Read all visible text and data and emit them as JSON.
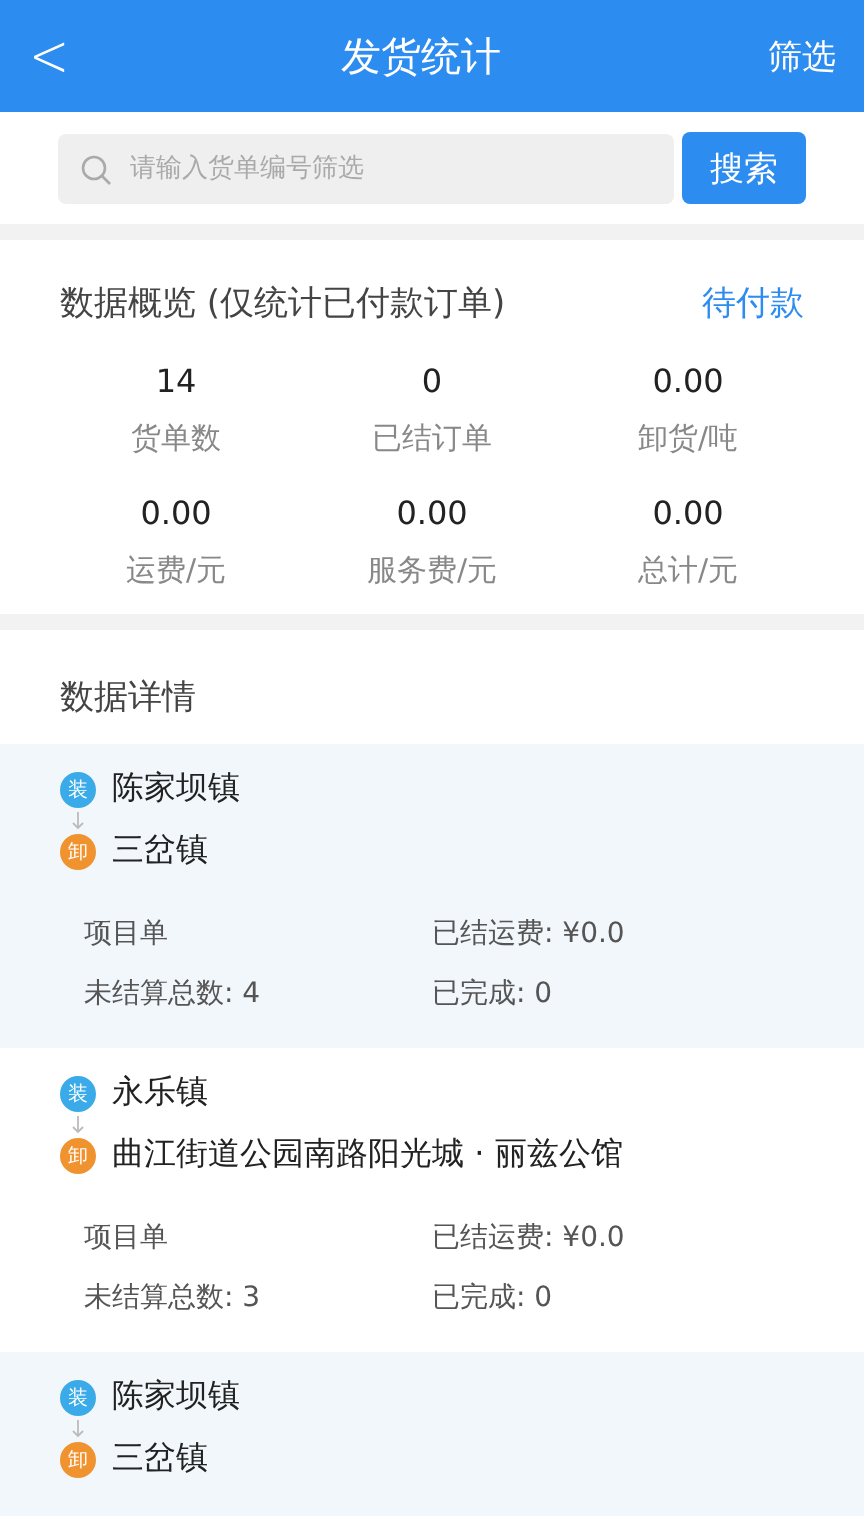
{
  "header": {
    "back": "<",
    "title": "发货统计",
    "action": "筛选"
  },
  "search": {
    "placeholder": "请输入货单编号筛选",
    "button": "搜索"
  },
  "overview": {
    "title": "数据概览 (仅统计已付款订单)",
    "link": "待付款",
    "stats": [
      {
        "value": "14",
        "label": "货单数"
      },
      {
        "value": "0",
        "label": "已结订单"
      },
      {
        "value": "0.00",
        "label": "卸货/吨"
      },
      {
        "value": "0.00",
        "label": "运费/元"
      },
      {
        "value": "0.00",
        "label": "服务费/元"
      },
      {
        "value": "0.00",
        "label": "总计/元"
      }
    ]
  },
  "details": {
    "title": "数据详情",
    "records": [
      {
        "load_tag": "装",
        "load": "陈家坝镇",
        "unload_tag": "卸",
        "unload": "三岔镇",
        "fields": [
          "项目单",
          "已结运费: ¥0.0",
          "未结算总数: 4",
          "已完成: 0"
        ]
      },
      {
        "load_tag": "装",
        "load": "永乐镇",
        "unload_tag": "卸",
        "unload": "曲江街道公园南路阳光城 · 丽兹公馆",
        "fields": [
          "项目单",
          "已结运费: ¥0.0",
          "未结算总数: 3",
          "已完成: 0"
        ]
      },
      {
        "load_tag": "装",
        "load": "陈家坝镇",
        "unload_tag": "卸",
        "unload": "三岔镇"
      }
    ]
  }
}
